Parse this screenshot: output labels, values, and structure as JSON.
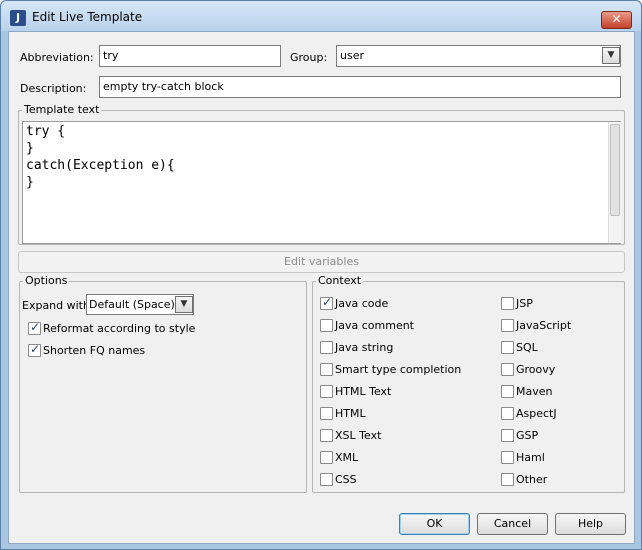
{
  "window": {
    "title": "Edit Live Template",
    "icon_name": "intellij-logo-icon",
    "icon_glyph": "J",
    "close_glyph": "✕"
  },
  "form": {
    "abbreviation_label": "Abbreviation:",
    "abbreviation_value": "try",
    "group_label": "Group:",
    "group_value": "user",
    "description_label": "Description:",
    "description_value": "empty try-catch block"
  },
  "template": {
    "group_title": "Template text",
    "lines": [
      "try {",
      "}",
      "catch(Exception e){",
      "}"
    ]
  },
  "edit_variables_label": "Edit variables",
  "options": {
    "group_title": "Options",
    "expand_with_label": "Expand with",
    "expand_with_value": "Default (Space)",
    "checkboxes": [
      {
        "label": "Reformat according to style",
        "checked": true
      },
      {
        "label": "Shorten FQ names",
        "checked": true
      }
    ]
  },
  "context": {
    "group_title": "Context",
    "left": [
      {
        "label": "Java code",
        "checked": true
      },
      {
        "label": "Java comment",
        "checked": false
      },
      {
        "label": "Java string",
        "checked": false
      },
      {
        "label": "Smart type completion",
        "checked": false
      },
      {
        "label": "HTML Text",
        "checked": false
      },
      {
        "label": "HTML",
        "checked": false
      },
      {
        "label": "XSL Text",
        "checked": false
      },
      {
        "label": "XML",
        "checked": false
      },
      {
        "label": "CSS",
        "checked": false
      }
    ],
    "right": [
      {
        "label": "JSP",
        "checked": false
      },
      {
        "label": "JavaScript",
        "checked": false
      },
      {
        "label": "SQL",
        "checked": false
      },
      {
        "label": "Groovy",
        "checked": false
      },
      {
        "label": "Maven",
        "checked": false
      },
      {
        "label": "AspectJ",
        "checked": false
      },
      {
        "label": "GSP",
        "checked": false
      },
      {
        "label": "Haml",
        "checked": false
      },
      {
        "label": "Other",
        "checked": false
      }
    ]
  },
  "buttons": {
    "ok": "OK",
    "cancel": "Cancel",
    "help": "Help"
  },
  "arrow_glyph": "▼"
}
